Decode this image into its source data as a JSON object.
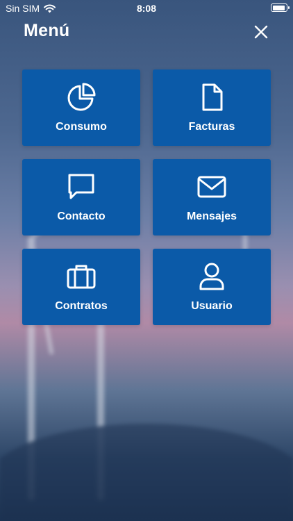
{
  "status_bar": {
    "carrier": "Sin SIM",
    "time": "8:08",
    "battery_level": 0.9
  },
  "header": {
    "title": "Menú"
  },
  "menu": {
    "items": [
      {
        "label": "Consumo",
        "icon": "pie-chart-icon"
      },
      {
        "label": "Facturas",
        "icon": "document-icon"
      },
      {
        "label": "Contacto",
        "icon": "chat-bubble-icon"
      },
      {
        "label": "Mensajes",
        "icon": "envelope-icon"
      },
      {
        "label": "Contratos",
        "icon": "briefcase-icon"
      },
      {
        "label": "Usuario",
        "icon": "user-icon"
      }
    ]
  },
  "colors": {
    "tile": "#0b5aa8",
    "text": "#ffffff"
  }
}
